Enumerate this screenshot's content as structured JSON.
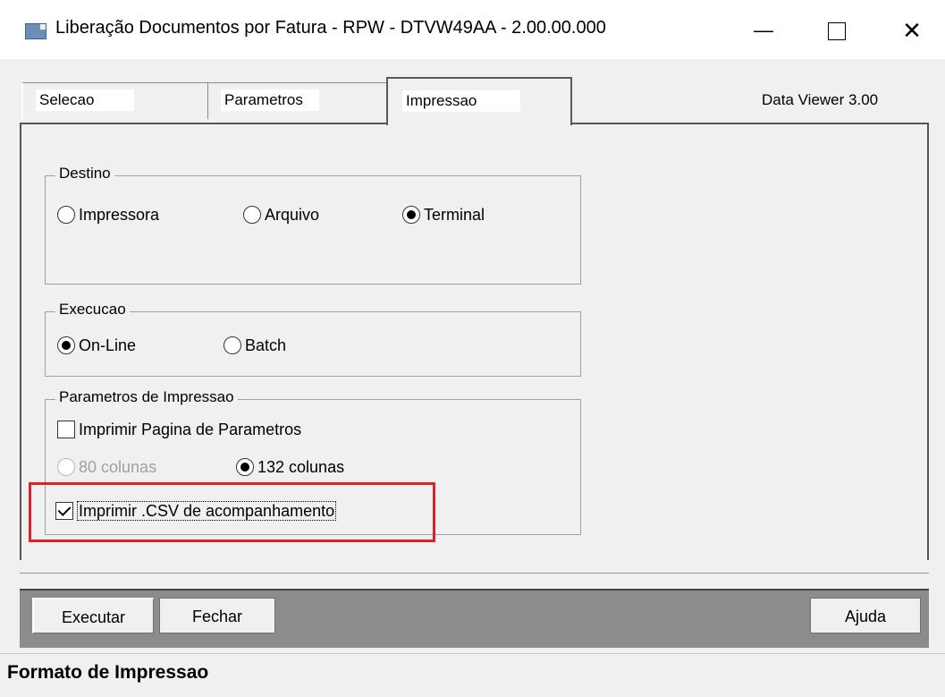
{
  "window": {
    "title": "Liberação Documentos por Fatura - RPW - DTVW49AA - 2.00.00.000",
    "minimize": "—",
    "close": "✕"
  },
  "tabs": [
    {
      "label": "Selecao"
    },
    {
      "label": "Parametros"
    },
    {
      "label": "Impressao",
      "active": true
    }
  ],
  "data_viewer": "Data Viewer 3.00",
  "destino": {
    "legend": "Destino",
    "options": [
      "Impressora",
      "Arquivo",
      "Terminal"
    ],
    "selected": "Terminal"
  },
  "execucao": {
    "legend": "Execucao",
    "options": [
      "On-Line",
      "Batch"
    ],
    "selected": "On-Line"
  },
  "parametros_impressao": {
    "legend": "Parametros de Impressao",
    "imprimir_pagina": "Imprimir Pagina de Parametros",
    "col80": "80 colunas",
    "col132": "132 colunas",
    "imprimir_csv": "Imprimir .CSV de acompanhamento"
  },
  "buttons": {
    "executar": "Executar",
    "fechar": "Fechar",
    "ajuda": "Ajuda"
  },
  "status": "Formato de Impressao",
  "colors": {
    "highlight": "#e0202a",
    "button_bar": "#8c8c8c"
  }
}
